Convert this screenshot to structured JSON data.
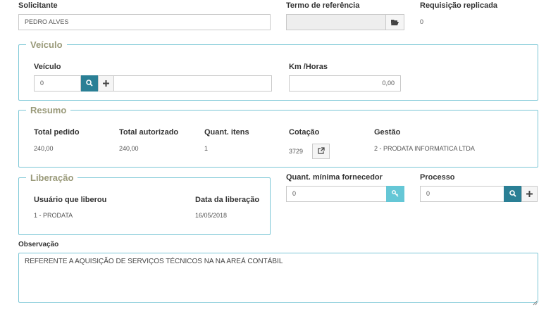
{
  "solicitante": {
    "label": "Solicitante",
    "value": "PEDRO ALVES"
  },
  "termo_referencia": {
    "label": "Termo de referência",
    "value": "",
    "folder_icon": "folder-open-icon"
  },
  "requisicao_replicada": {
    "label": "Requisição replicada",
    "value": "0"
  },
  "veiculo_section": {
    "legend": "Veículo",
    "veiculo": {
      "label": "Veículo",
      "value": "0",
      "description": ""
    },
    "km_horas": {
      "label": "Km /Horas",
      "value": "0,00"
    }
  },
  "resumo": {
    "legend": "Resumo",
    "total_pedido": {
      "label": "Total pedido",
      "value": "240,00"
    },
    "total_autorizado": {
      "label": "Total autorizado",
      "value": "240,00"
    },
    "quant_itens": {
      "label": "Quant. itens",
      "value": "1"
    },
    "cotacao": {
      "label": "Cotação",
      "value": "3729"
    },
    "gestao": {
      "label": "Gestão",
      "value": "2 - PRODATA INFORMATICA LTDA"
    }
  },
  "liberacao": {
    "legend": "Liberação",
    "usuario": {
      "label": "Usuário que liberou",
      "value": "1 - PRODATA"
    },
    "data": {
      "label": "Data da liberação",
      "value": "16/05/2018"
    }
  },
  "quant_minima": {
    "label": "Quant. mínima fornecedor",
    "value": "0"
  },
  "processo": {
    "label": "Processo",
    "value": "0"
  },
  "observacao": {
    "label": "Observação",
    "value": "REFERENTE A AQUISIÇÃO DE SERVIÇOS TÉCNICOS NA NA AREÁ CONTÁBIL"
  },
  "colors": {
    "accent": "#2a7f95",
    "accent_light": "#65c7d6",
    "border": "#7cc7d6",
    "legend": "#9a9a7a"
  }
}
